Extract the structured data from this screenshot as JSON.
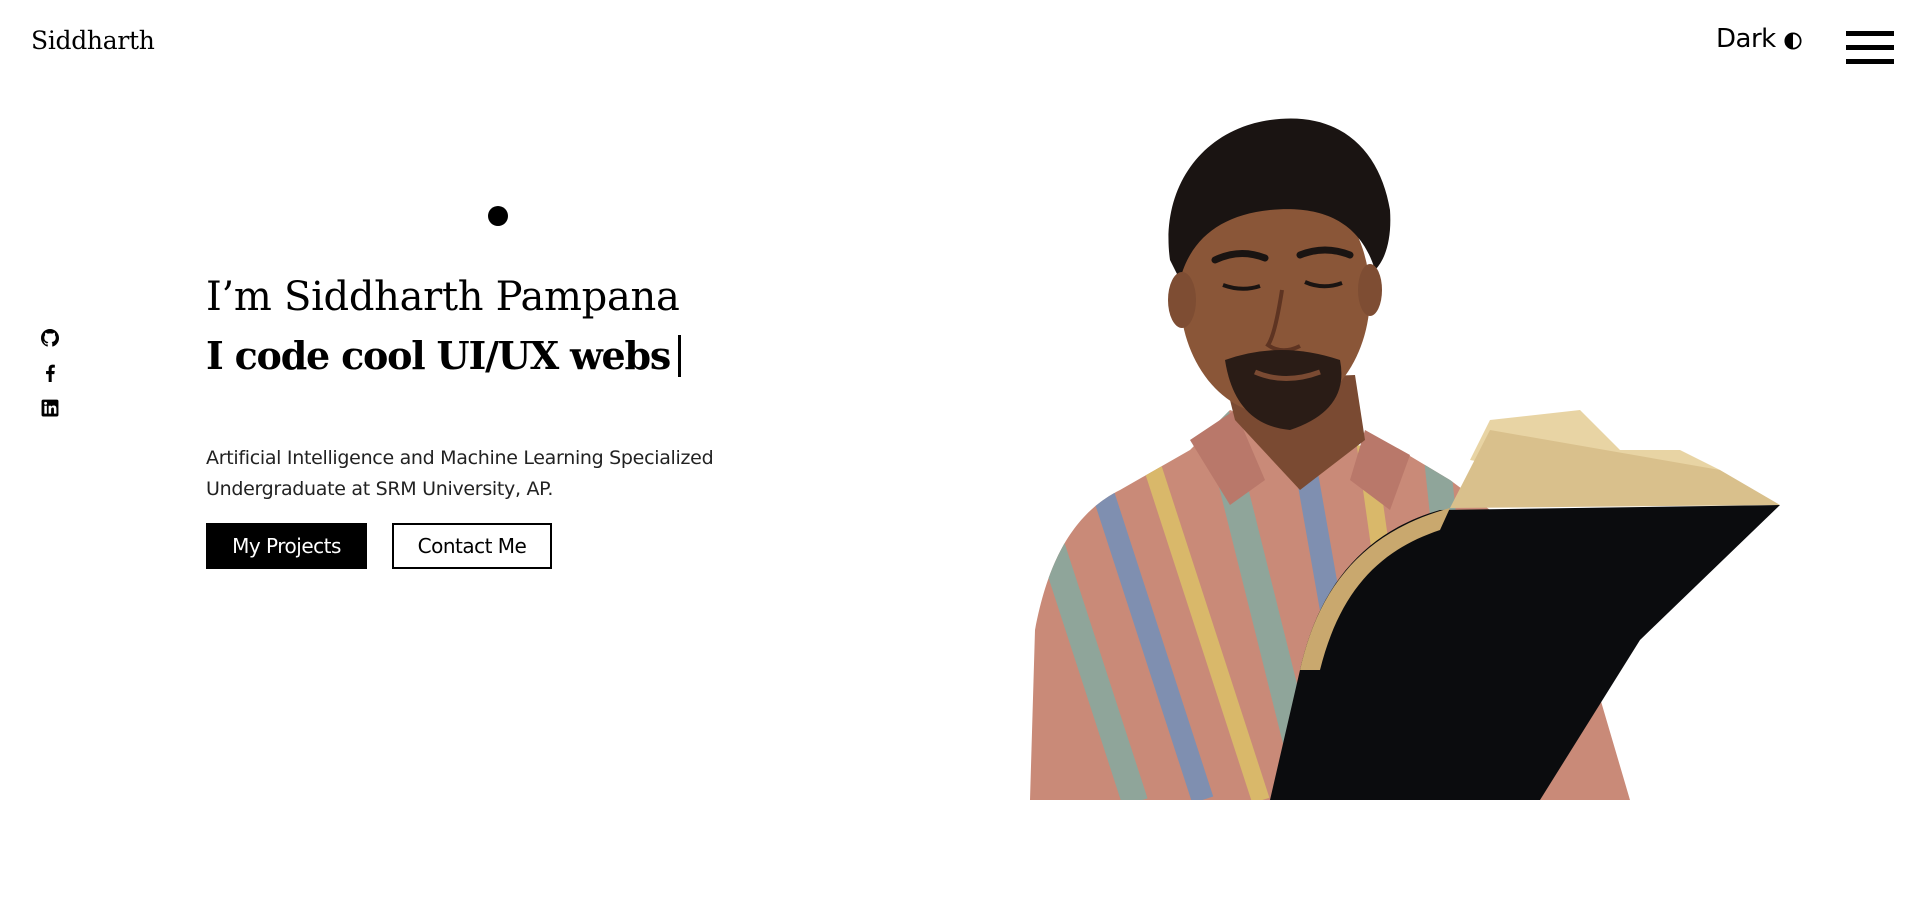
{
  "header": {
    "brand": "Siddharth",
    "theme_toggle_label": "Dark",
    "theme_icon": "contrast-icon",
    "menu_icon": "hamburger-menu-icon"
  },
  "social": [
    {
      "name": "github",
      "icon": "github-icon"
    },
    {
      "name": "facebook",
      "icon": "facebook-icon"
    },
    {
      "name": "linkedin",
      "icon": "linkedin-icon"
    }
  ],
  "hero": {
    "title": "I’m Siddharth Pampana",
    "typed_text": "I code cool UI/UX webs",
    "description_line1": "Artificial Intelligence and Machine Learning Specialized",
    "description_line2": "Undergraduate at SRM University, AP.",
    "primary_button": "My Projects",
    "secondary_button": "Contact Me"
  },
  "colors": {
    "background": "#ffffff",
    "text": "#000000",
    "button_primary_bg": "#000000",
    "button_primary_text": "#ffffff"
  }
}
